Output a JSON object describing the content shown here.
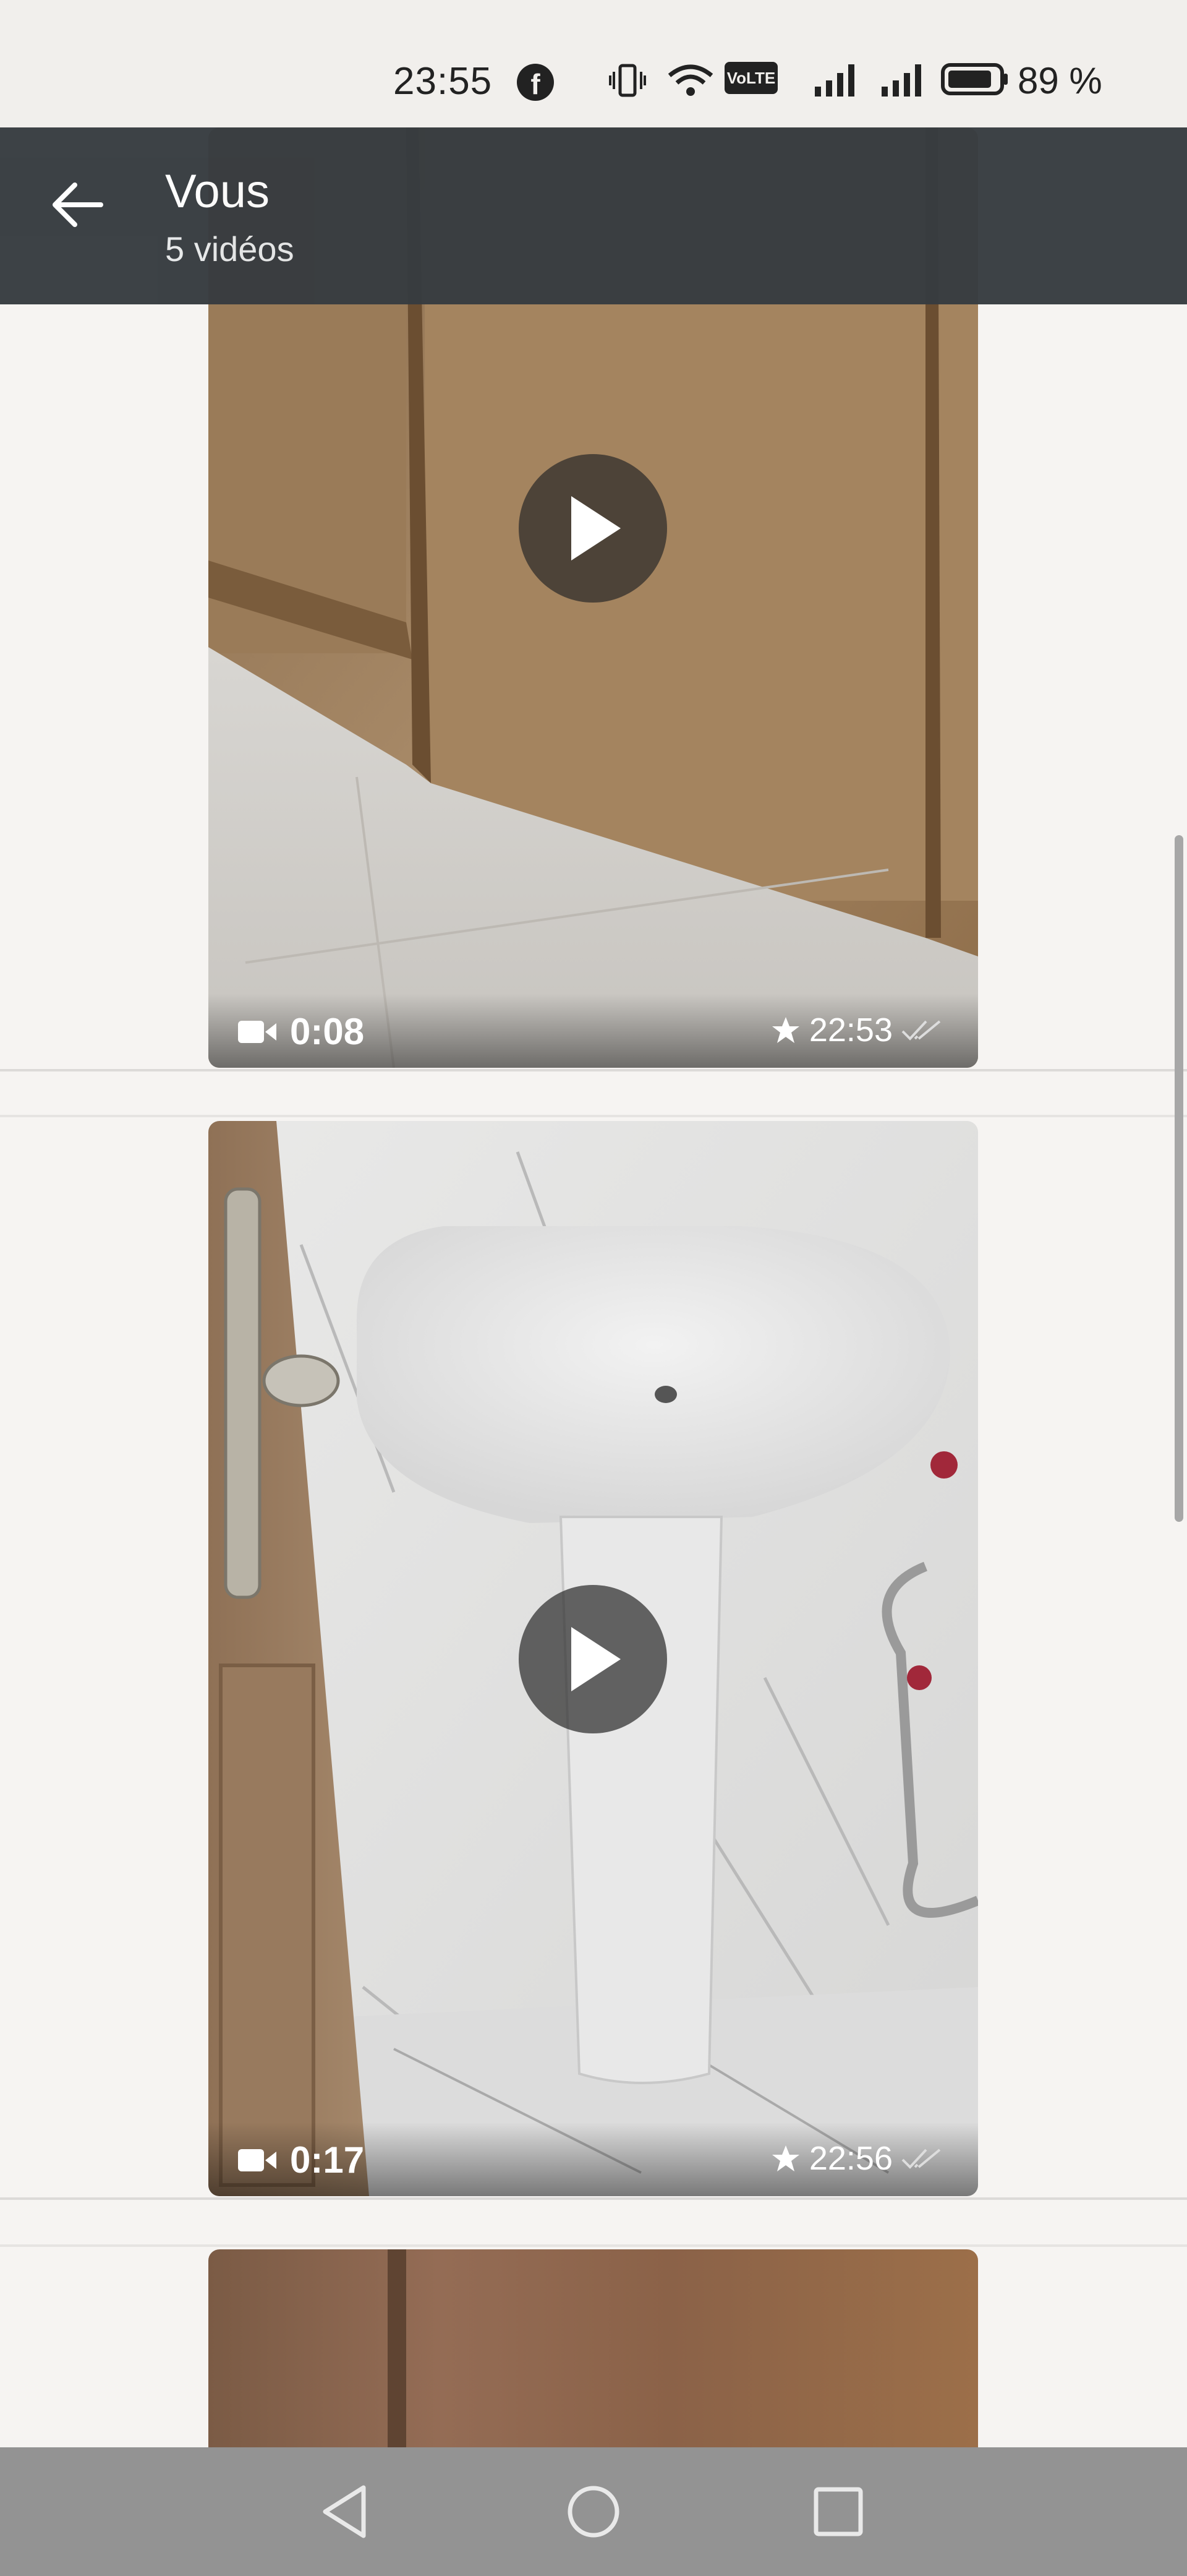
{
  "status_bar": {
    "time": "23:55",
    "facebook_glyph": "f",
    "volte": "VoLTE",
    "battery_percent": "89 %",
    "battery_level": 0.89,
    "icons": [
      "facebook-icon",
      "vibrate-icon",
      "wifi-icon",
      "volte-icon",
      "signal-icon",
      "signal-icon",
      "battery-icon"
    ]
  },
  "header": {
    "title": "Vous",
    "subtitle": "5 vidéos",
    "back_icon": "arrow-left-icon"
  },
  "videos": [
    {
      "duration": "0:08",
      "time": "22:53",
      "starred": true,
      "read": true
    },
    {
      "duration": "0:17",
      "time": "22:56",
      "starred": true,
      "read": true
    },
    {
      "duration": "",
      "time": "",
      "starred": false,
      "read": false
    }
  ],
  "nav": {
    "icons": [
      "back-triangle-icon",
      "home-circle-icon",
      "recents-square-icon"
    ]
  },
  "colors": {
    "app_bar": "#373c40",
    "background": "#f6f4f2",
    "nav_bar": "#939393"
  }
}
